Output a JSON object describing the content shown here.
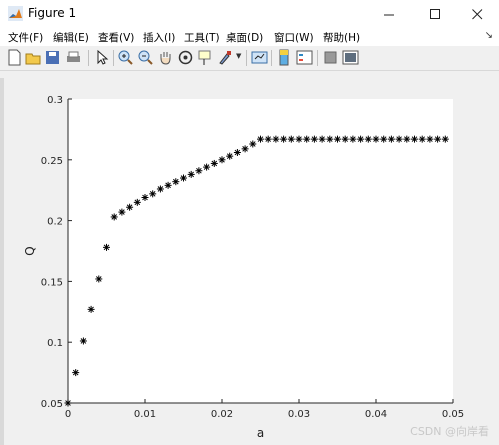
{
  "window": {
    "title": "Figure 1",
    "minimize_icon": "minimize-icon",
    "maximize_icon": "maximize-icon",
    "close_icon": "close-icon"
  },
  "menu": [
    "文件(F)",
    "编辑(E)",
    "查看(V)",
    "插入(I)",
    "工具(T)",
    "桌面(D)",
    "窗口(W)",
    "帮助(H)"
  ],
  "toolbar": {
    "icons": [
      "new-figure-icon",
      "open-file-icon",
      "save-icon",
      "print-icon",
      "select-arrow-icon",
      "zoom-in-icon",
      "zoom-out-icon",
      "pan-hand-icon",
      "rotate-3d-icon",
      "data-cursor-icon",
      "brush-icon",
      "link-plot-icon",
      "colorbar-icon",
      "legend-icon",
      "hide-plot-tools-icon",
      "show-plot-tools-icon"
    ]
  },
  "chart_data": {
    "type": "scatter",
    "marker": "*",
    "marker_color": "#000000",
    "xlabel": "a",
    "ylabel": "Q",
    "xlim": [
      0,
      0.05
    ],
    "ylim": [
      0.05,
      0.3
    ],
    "xticks": [
      "0",
      "0.01",
      "0.02",
      "0.03",
      "0.04",
      "0.05"
    ],
    "yticks": [
      "0.05",
      "0.1",
      "0.15",
      "0.2",
      "0.25",
      "0.3"
    ],
    "grid": false,
    "x": [
      0,
      0.001,
      0.002,
      0.003,
      0.004,
      0.005,
      0.006,
      0.007,
      0.008,
      0.009,
      0.01,
      0.011,
      0.012,
      0.013,
      0.014,
      0.015,
      0.016,
      0.017,
      0.018,
      0.019,
      0.02,
      0.021,
      0.022,
      0.023,
      0.024,
      0.025,
      0.026,
      0.027,
      0.028,
      0.029,
      0.03,
      0.031,
      0.032,
      0.033,
      0.034,
      0.035,
      0.036,
      0.037,
      0.038,
      0.039,
      0.04,
      0.041,
      0.042,
      0.043,
      0.044,
      0.045,
      0.046,
      0.047,
      0.048,
      0.049
    ],
    "y": [
      0.05,
      0.075,
      0.101,
      0.127,
      0.152,
      0.178,
      0.203,
      0.207,
      0.211,
      0.215,
      0.219,
      0.222,
      0.226,
      0.229,
      0.232,
      0.235,
      0.238,
      0.241,
      0.244,
      0.247,
      0.25,
      0.253,
      0.256,
      0.259,
      0.263,
      0.267,
      0.267,
      0.267,
      0.267,
      0.267,
      0.267,
      0.267,
      0.267,
      0.267,
      0.267,
      0.267,
      0.267,
      0.267,
      0.267,
      0.267,
      0.267,
      0.267,
      0.267,
      0.267,
      0.267,
      0.267,
      0.267,
      0.267,
      0.267,
      0.267
    ]
  },
  "watermark": "CSDN @向岸看"
}
